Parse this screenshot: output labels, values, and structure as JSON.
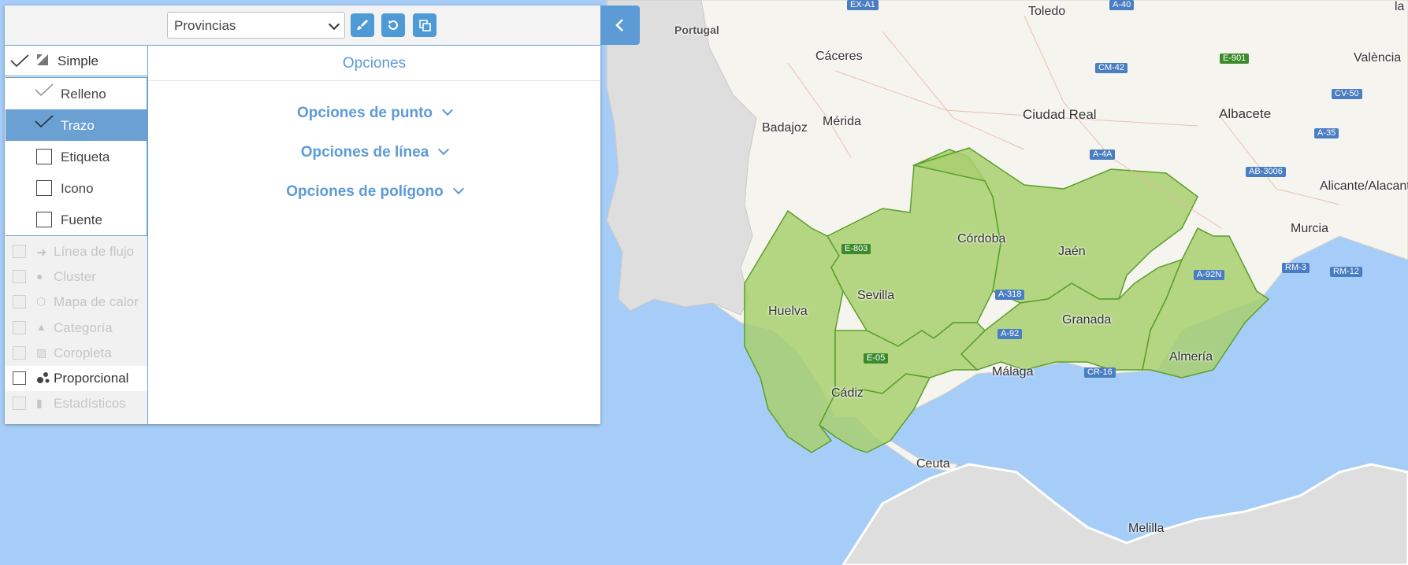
{
  "toolbar": {
    "layer_select_value": "Provincias",
    "buttons": [
      "brush-icon",
      "reset-icon",
      "copy-icon"
    ],
    "collapse_icon": "chevron-left-icon"
  },
  "style_list": {
    "simple": {
      "label": "Simple",
      "checked": true
    },
    "sub_items": [
      {
        "label": "Relleno",
        "checked": true,
        "active": false
      },
      {
        "label": "Trazo",
        "checked": true,
        "active": true
      },
      {
        "label": "Etiqueta",
        "checked": false,
        "active": false
      },
      {
        "label": "Icono",
        "checked": false,
        "active": false
      },
      {
        "label": "Fuente",
        "checked": false,
        "active": false
      }
    ],
    "analysis_items": [
      {
        "label": "Línea de flujo",
        "icon": "arrow-right-icon",
        "enabled": false
      },
      {
        "label": "Cluster",
        "icon": "cluster-icon",
        "enabled": false
      },
      {
        "label": "Mapa de calor",
        "icon": "heatmap-icon",
        "enabled": false
      },
      {
        "label": "Categoría",
        "icon": "shapes-icon",
        "enabled": false
      },
      {
        "label": "Coropleta",
        "icon": "choropleth-icon",
        "enabled": false
      },
      {
        "label": "Proporcional",
        "icon": "proportional-icon",
        "enabled": true
      },
      {
        "label": "Estadísticos",
        "icon": "bar-chart-icon",
        "enabled": false
      }
    ]
  },
  "options": {
    "title": "Opciones",
    "sections": [
      "Opciones de punto",
      "Opciones de línea",
      "Opciones de polígono"
    ]
  },
  "map": {
    "colors": {
      "water": "#a6cdf7",
      "land": "#f6f4ef",
      "foreign_land": "#dedede",
      "region_fill": "#a8cf6e",
      "region_stroke": "#5aa02c"
    },
    "cities": [
      "Toledo",
      "Portugal",
      "Cáceres",
      "València",
      "Badajoz",
      "Mérida",
      "Ciudad Real",
      "Albacete",
      "Córdoba",
      "Jaén",
      "Alicante/Alacant",
      "Murcia",
      "Sevilla",
      "Huelva",
      "Granada",
      "Almería",
      "Málaga",
      "Cádiz",
      "Ceuta",
      "Melilla",
      "la P"
    ],
    "roads": [
      "EX-A1",
      "A-40",
      "CM-42",
      "E-901",
      "CV-50",
      "A-35",
      "A-4A",
      "AB-3006",
      "E-803",
      "RM-3",
      "RM-12",
      "A-92N",
      "A-318",
      "A-92",
      "E-05",
      "CR-16"
    ]
  }
}
